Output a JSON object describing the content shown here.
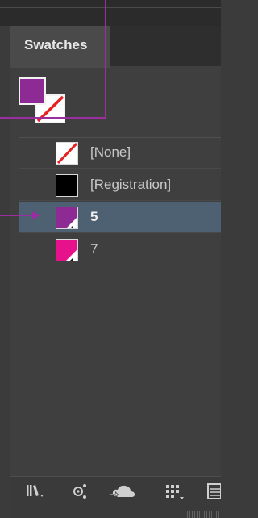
{
  "panel": {
    "tab_label": "Swatches"
  },
  "fill_stroke": {
    "fill_color": "#8e2a93",
    "stroke": "none"
  },
  "swatches": [
    {
      "label": "[None]",
      "color": "none",
      "selected": false
    },
    {
      "label": "[Registration]",
      "color": "#000000",
      "selected": false
    },
    {
      "label": "5",
      "color": "#8e2a93",
      "selected": true
    },
    {
      "label": "7",
      "color": "#e8118c",
      "selected": false
    }
  ],
  "bottom_icons": [
    "libraries-icon",
    "color-theme-icon",
    "cloud-sync-icon",
    "swatch-grid-icon",
    "list-view-icon"
  ],
  "colors": {
    "callout": "#9b2d9f",
    "selection": "#4d6172"
  }
}
